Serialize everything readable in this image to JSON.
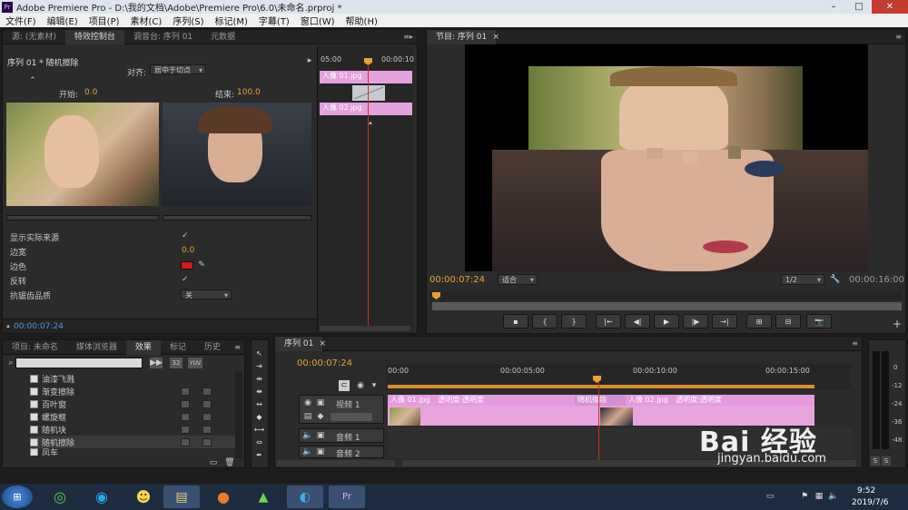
{
  "titlebar": {
    "app_icon": "Pr",
    "title": "Adobe Premiere Pro - D:\\我的文档\\Adobe\\Premiere Pro\\6.0\\未命名.prproj *",
    "minimize": "–",
    "maximize": "□",
    "close": "✕"
  },
  "menu": [
    "文件(F)",
    "编辑(E)",
    "项目(P)",
    "素材(C)",
    "序列(S)",
    "标记(M)",
    "字幕(T)",
    "窗口(W)",
    "帮助(H)"
  ],
  "effect_controls": {
    "tabs": [
      "源: (无素材)",
      "特效控制台",
      "调音台: 序列 01",
      "元数据"
    ],
    "header": "序列 01 * 随机擦除",
    "align_label": "对齐:",
    "align_value": "居中于切点",
    "start_label": "开始:",
    "start_value": "0.0",
    "end_label": "结束:",
    "end_value": "100.0",
    "props": [
      {
        "label": "显示实际来源",
        "value": "✓"
      },
      {
        "label": "边宽",
        "value": "0.0"
      },
      {
        "label": "边色",
        "value": ""
      },
      {
        "label": "反转",
        "value": "✓"
      },
      {
        "label": "抗锯齿品质",
        "value": "关"
      }
    ],
    "border_color": "#cc1e1e",
    "timecode": "00:00:07:24",
    "mini_timeline": {
      "t0": "05:00",
      "t1": "00:00:10",
      "clip_a": "人像 01.jpg",
      "clip_b": "人像 02.jpg"
    }
  },
  "program_monitor": {
    "tab": "节目: 序列 01",
    "timecode": "00:00:07:24",
    "fit": "适合",
    "quality": "1/2",
    "duration": "00:00:16:00"
  },
  "transport": [
    "▪",
    "{",
    "}",
    "|←",
    "◀|",
    "▶",
    "|▶",
    "→|",
    "⊞",
    "⊟",
    "📷"
  ],
  "project_panel": {
    "tabs": [
      "项目: 未命名",
      "媒体浏览器",
      "效果",
      "标记",
      "历史"
    ],
    "search_placeholder": "",
    "btn_labels": [
      "32",
      "YUV"
    ],
    "effects": [
      "油漆飞溅",
      "渐变擦除",
      "百叶窗",
      "螺旋框",
      "随机块",
      "随机擦除",
      "风车"
    ]
  },
  "timeline": {
    "tab": "序列 01",
    "timecode": "00:00:07:24",
    "ruler": [
      "00:00",
      "00:00:05:00",
      "00:00:10:00",
      "00:00:15:00"
    ],
    "tracks": [
      {
        "name": "视频 1"
      },
      {
        "name": "音频 1"
      },
      {
        "name": "音频 2"
      }
    ],
    "clips": [
      {
        "name": "人像 01.jpg",
        "fx": "透明度:透明度"
      },
      {
        "name": "随机擦除",
        "fx": ""
      },
      {
        "name": "人像 02.jpg",
        "fx": "透明度:透明度"
      }
    ],
    "vu_scale": [
      "0",
      "-12",
      "-24",
      "-36",
      "-48"
    ],
    "vu_buttons": [
      "S",
      "S"
    ]
  },
  "taskbar": {
    "clock": "9:52",
    "date": "2019/7/6",
    "apps": [
      "start",
      "360",
      "ie-like",
      "qq",
      "explorer",
      "firefox",
      "media",
      "vscode-like",
      "premiere"
    ]
  },
  "watermark": {
    "logo": "Bai 经验",
    "url": "jingyan.baidu.com"
  }
}
